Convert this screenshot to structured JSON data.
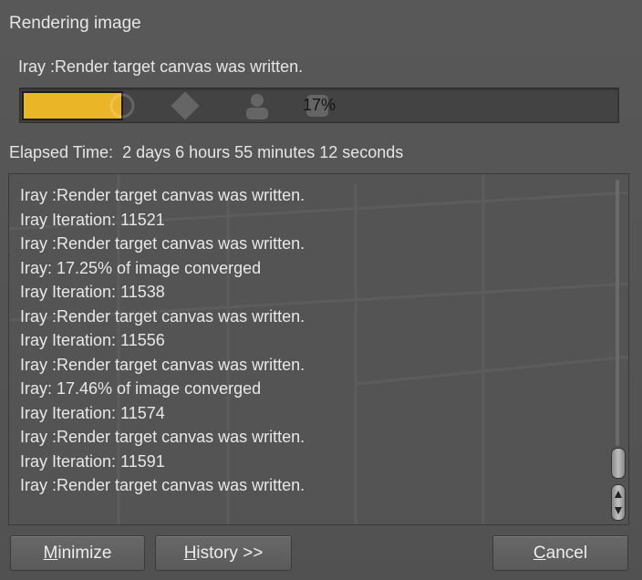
{
  "dialog": {
    "title": "Rendering image",
    "status_text": "Iray :Render target canvas was written.",
    "progress": {
      "percent": 17,
      "label": "17%",
      "fill_color": "#eab627"
    },
    "elapsed_label": "Elapsed Time:",
    "elapsed_value": "2 days 6 hours 55 minutes 12 seconds"
  },
  "log": {
    "lines": [
      "Iray :Render target canvas was written.",
      "Iray Iteration: 11521",
      "Iray :Render target canvas was written.",
      "Iray: 17.25% of image converged",
      "Iray Iteration: 11538",
      "Iray :Render target canvas was written.",
      "Iray Iteration: 11556",
      "Iray :Render target canvas was written.",
      "Iray: 17.46% of image converged",
      "Iray Iteration: 11574",
      "Iray :Render target canvas was written.",
      "Iray Iteration: 11591",
      "Iray :Render target canvas was written."
    ]
  },
  "buttons": {
    "minimize": {
      "accel": "M",
      "rest": "inimize"
    },
    "history": {
      "accel": "H",
      "rest": "istory >>"
    },
    "cancel": {
      "accel": "C",
      "rest": "ancel"
    }
  }
}
